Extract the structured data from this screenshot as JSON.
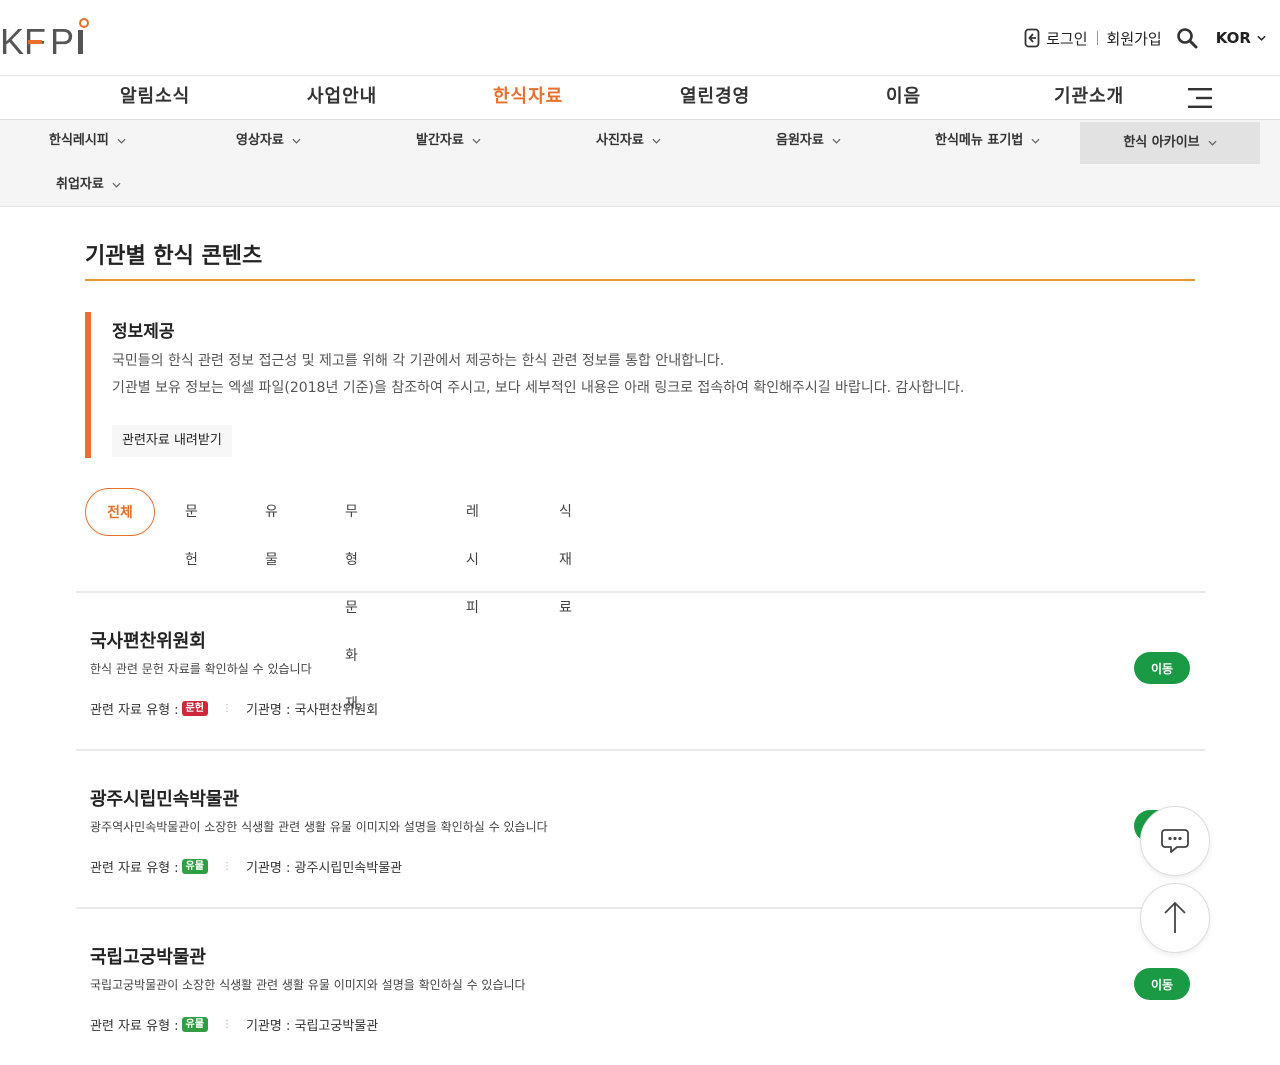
{
  "header": {
    "logo_text": "KFPI",
    "login_label": "로그인",
    "signup_label": "회원가입",
    "lang_label": "KOR"
  },
  "gnb": [
    {
      "label": "알림소식"
    },
    {
      "label": "사업안내"
    },
    {
      "label": "한식자료"
    },
    {
      "label": "열린경영"
    },
    {
      "label": "이음"
    },
    {
      "label": "기관소개"
    }
  ],
  "lnb": [
    {
      "label": "한식레시피"
    },
    {
      "label": "영상자료"
    },
    {
      "label": "발간자료"
    },
    {
      "label": "사진자료"
    },
    {
      "label": "음원자료"
    },
    {
      "label": "한식메뉴 표기법"
    },
    {
      "label": "한식 아카이브"
    },
    {
      "label": "취업자료"
    }
  ],
  "page": {
    "title": "기관별 한식 콘텐츠"
  },
  "info": {
    "title": "정보제공",
    "line1": "국민들의 한식 관련 정보 접근성 및 제고를 위해 각 기관에서 제공하는 한식 관련 정보를 통합 안내합니다.",
    "line2": "기관별 보유 정보는 엑셀 파일(2018년 기준)을 참조하여 주시고, 보다 세부적인 내용은 아래 링크로 접속하여 확인해주시길 바랍니다. 감사합니다.",
    "download_label": "관련자료 내려받기"
  },
  "tabs": [
    {
      "label": "전체"
    },
    {
      "label": "문헌"
    },
    {
      "label": "유물"
    },
    {
      "label": "무형문화재"
    },
    {
      "label": "레시피"
    },
    {
      "label": "식재료"
    }
  ],
  "rows": [
    {
      "name": "국사편찬위원회",
      "desc": "한식 관련 문헌 자료를 확인하실 수 있습니다",
      "type_label": "관련 자료 유형 :",
      "type_badge": "문헌",
      "badge_color": "#d0263a",
      "org_label": "기관명 : 국사편찬위원회",
      "go_label": "이동"
    },
    {
      "name": "광주시립민속박물관",
      "desc": "광주역사민속박물관이 소장한 식생활 관련 생활 유물 이미지와 설명을 확인하실 수 있습니다",
      "type_label": "관련 자료 유형 :",
      "type_badge": "유물",
      "badge_color": "#2ea043",
      "org_label": "기관명 : 광주시립민속박물관",
      "go_label": "이동"
    },
    {
      "name": "국립고궁박물관",
      "desc": "국립고궁박물관이 소장한 식생활 관련 생활 유물 이미지와 설명을 확인하실 수 있습니다",
      "type_label": "관련 자료 유형 :",
      "type_badge": "유물",
      "badge_color": "#2ea043",
      "org_label": "기관명 : 국립고궁박물관",
      "go_label": "이동"
    }
  ],
  "colors": {
    "accent": "#e8702a",
    "go_button": "#1a9a45"
  },
  "icons": [
    "login-icon",
    "search-icon",
    "chevron-down-icon",
    "menu-icon",
    "chat-icon",
    "arrow-up-icon"
  ]
}
